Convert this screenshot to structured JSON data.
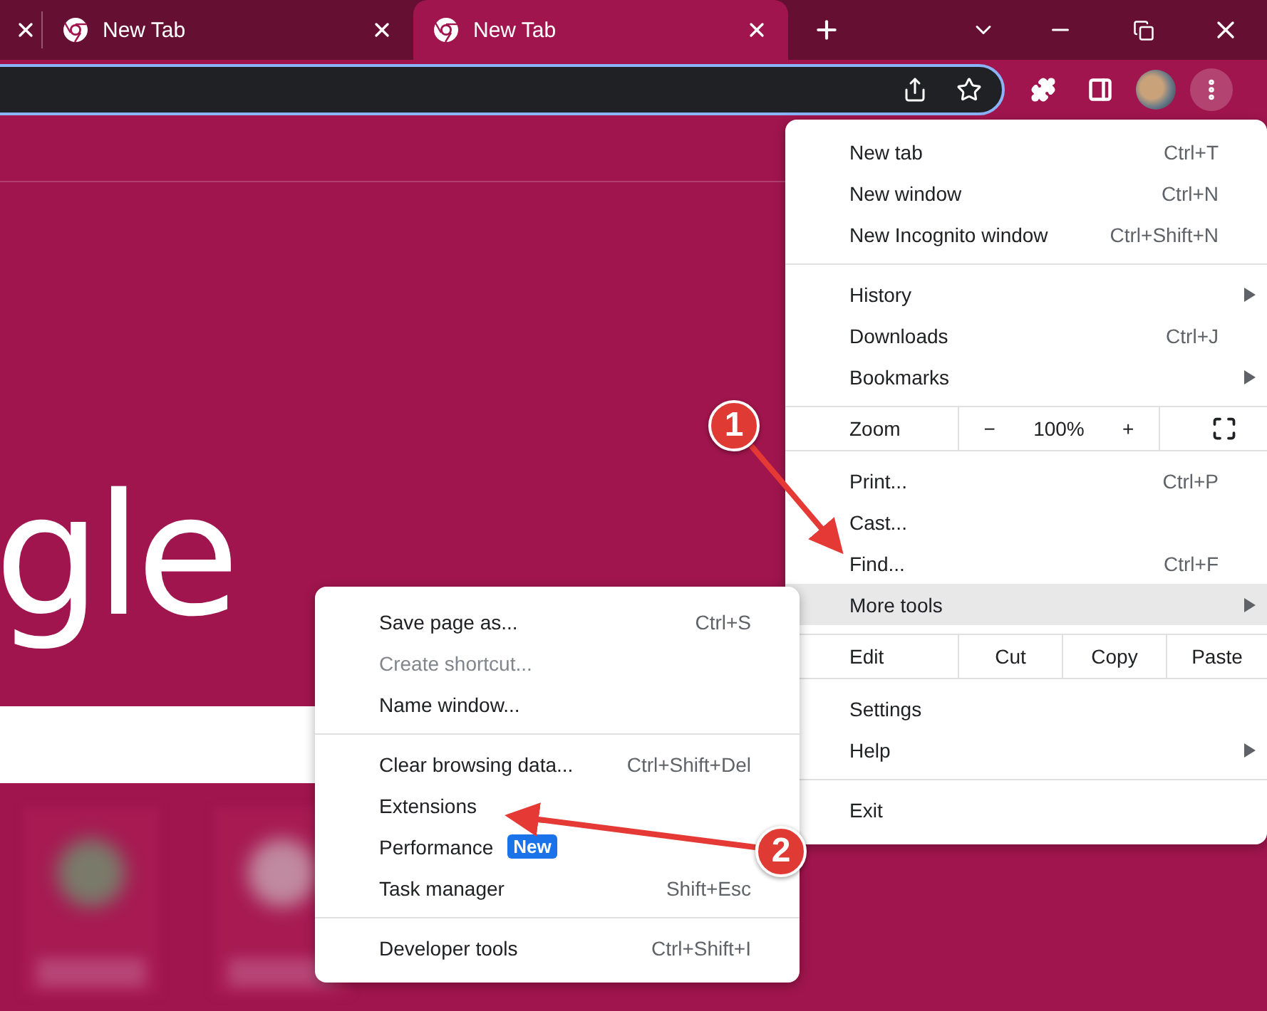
{
  "tabs": [
    {
      "title": "New Tab",
      "selected": false
    },
    {
      "title": "New Tab",
      "selected": true
    }
  ],
  "page": {
    "logo_text": "gle"
  },
  "menu": {
    "sections": [
      [
        {
          "kind": "item",
          "label": "New tab",
          "shortcut": "Ctrl+T",
          "submenu": false,
          "selected": false
        },
        {
          "kind": "item",
          "label": "New window",
          "shortcut": "Ctrl+N",
          "submenu": false,
          "selected": false
        },
        {
          "kind": "item",
          "label": "New Incognito window",
          "shortcut": "Ctrl+Shift+N",
          "submenu": false,
          "selected": false
        }
      ],
      [
        {
          "kind": "item",
          "label": "History",
          "submenu": true,
          "selected": false
        },
        {
          "kind": "item",
          "label": "Downloads",
          "shortcut": "Ctrl+J",
          "submenu": false,
          "selected": false
        },
        {
          "kind": "item",
          "label": "Bookmarks",
          "submenu": true,
          "selected": false
        }
      ],
      [
        {
          "kind": "zoom",
          "label": "Zoom",
          "minus": "−",
          "value": "100%",
          "plus": "+"
        }
      ],
      [
        {
          "kind": "item",
          "label": "Print...",
          "shortcut": "Ctrl+P",
          "submenu": false,
          "selected": false
        },
        {
          "kind": "item",
          "label": "Cast...",
          "submenu": false,
          "selected": false
        },
        {
          "kind": "item",
          "label": "Find...",
          "shortcut": "Ctrl+F",
          "submenu": false,
          "selected": false
        },
        {
          "kind": "item",
          "label": "More tools",
          "submenu": true,
          "selected": true
        }
      ],
      [
        {
          "kind": "edit",
          "label": "Edit",
          "buttons": [
            "Cut",
            "Copy",
            "Paste"
          ]
        }
      ],
      [
        {
          "kind": "item",
          "label": "Settings",
          "submenu": false,
          "selected": false
        },
        {
          "kind": "item",
          "label": "Help",
          "submenu": true,
          "selected": false
        }
      ],
      [
        {
          "kind": "item",
          "label": "Exit",
          "submenu": false,
          "selected": false
        }
      ]
    ]
  },
  "submenu": {
    "sections": [
      [
        {
          "label": "Save page as...",
          "shortcut": "Ctrl+S",
          "disabled": false
        },
        {
          "label": "Create shortcut...",
          "disabled": true
        },
        {
          "label": "Name window...",
          "disabled": false
        }
      ],
      [
        {
          "label": "Clear browsing data...",
          "shortcut": "Ctrl+Shift+Del",
          "disabled": false
        },
        {
          "label": "Extensions",
          "disabled": false
        },
        {
          "label": "Performance",
          "badge": "New",
          "disabled": false
        },
        {
          "label": "Task manager",
          "shortcut": "Shift+Esc",
          "disabled": false
        }
      ],
      [
        {
          "label": "Developer tools",
          "shortcut": "Ctrl+Shift+I",
          "disabled": false
        }
      ]
    ]
  },
  "annotations": [
    {
      "number": "1"
    },
    {
      "number": "2"
    }
  ]
}
